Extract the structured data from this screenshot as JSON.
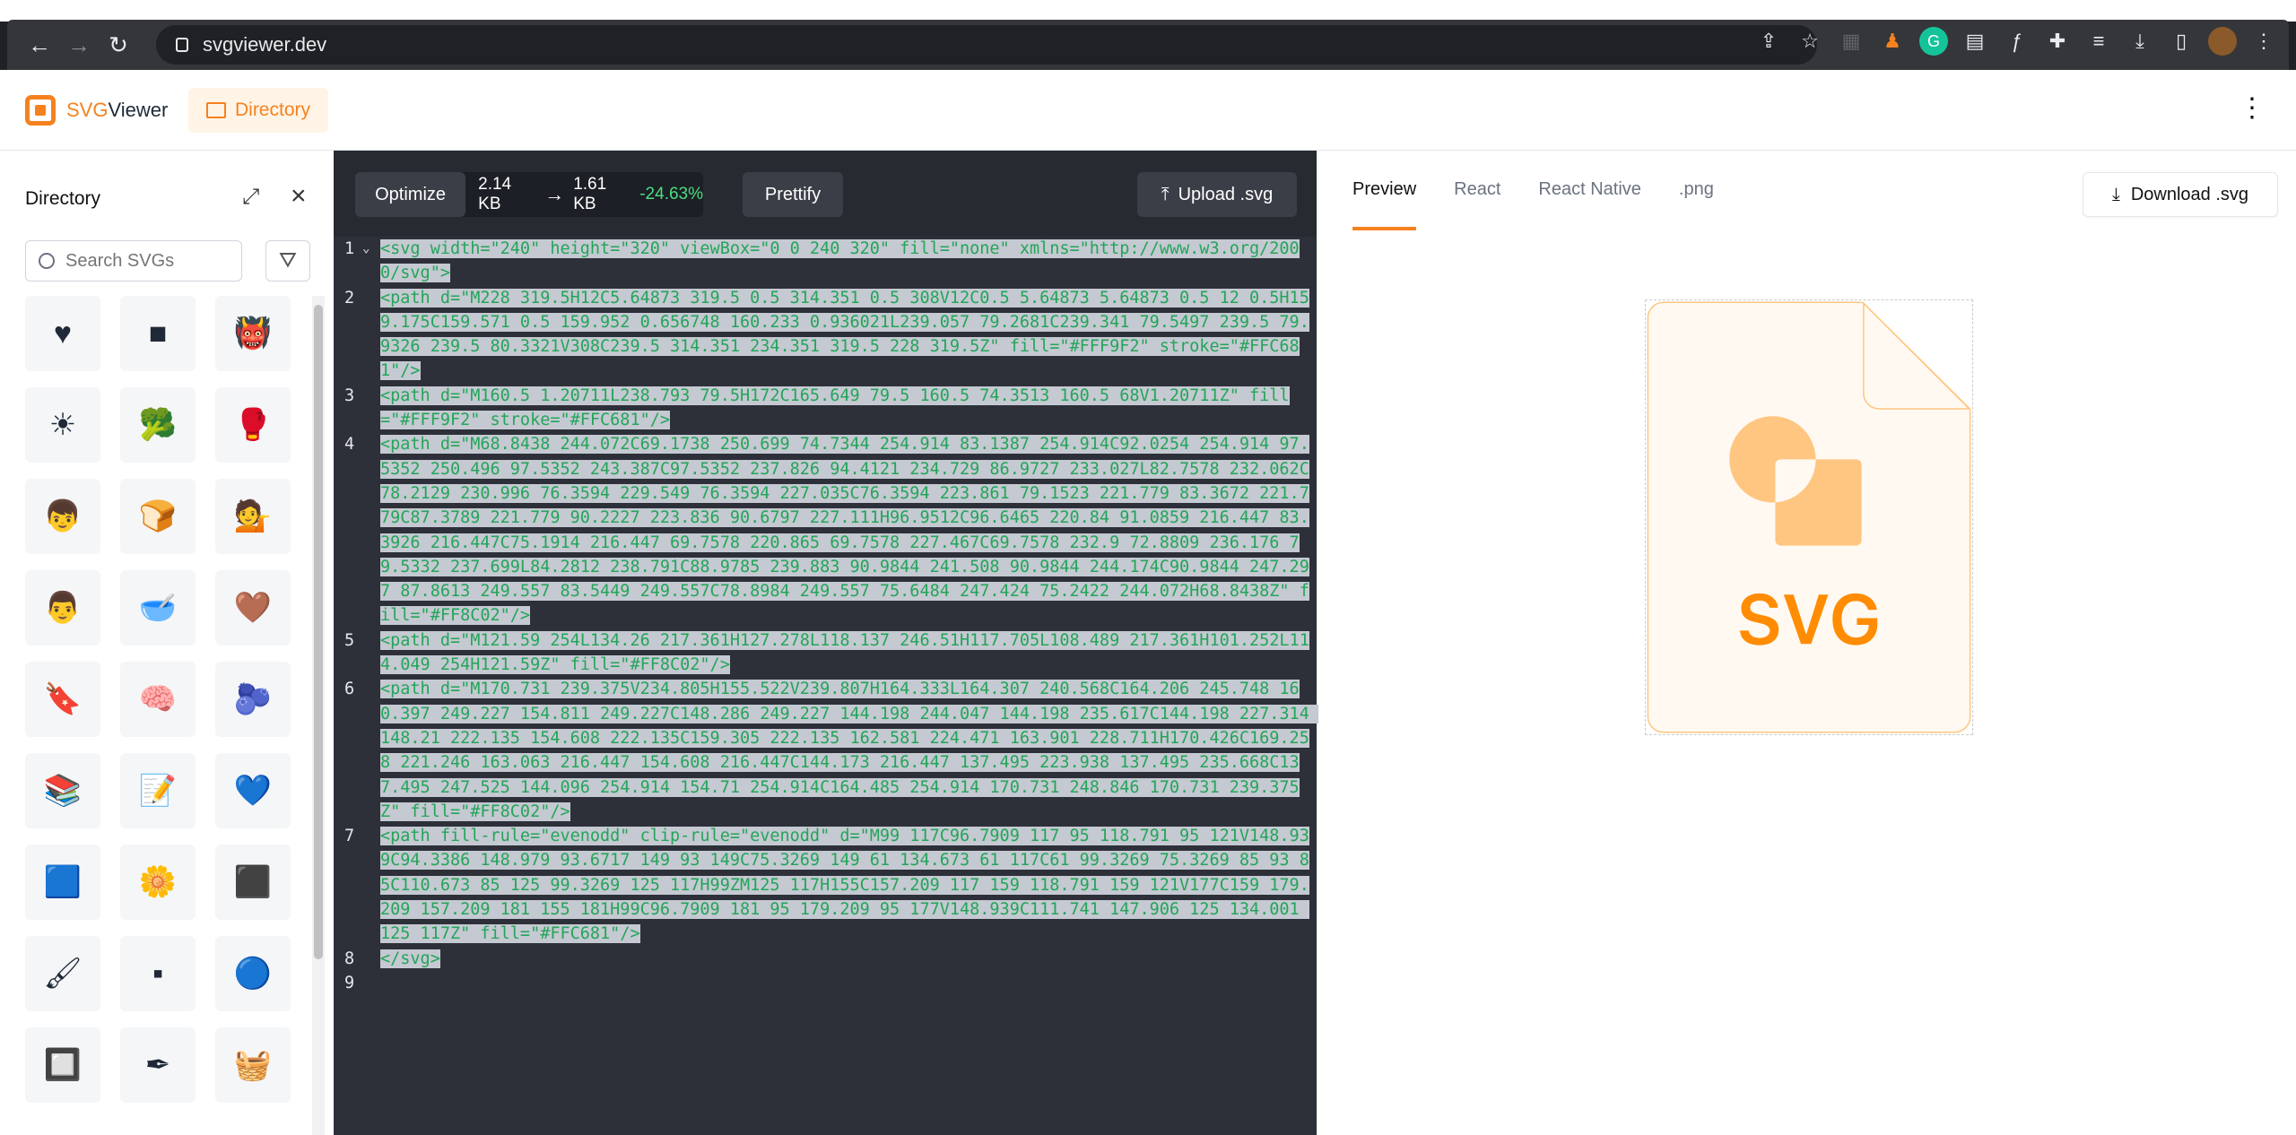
{
  "browser": {
    "url": "svgviewer.dev"
  },
  "header": {
    "logo_svg": "SVG",
    "logo_viewer": "Viewer",
    "directory_label": "Directory"
  },
  "sidebar": {
    "title": "Directory",
    "search_placeholder": "Search SVGs",
    "icons": [
      "heart",
      "black-square",
      "ogre",
      "sun",
      "broccoli",
      "boxing-glove",
      "boy-face",
      "bread",
      "woman-gesture",
      "medium-dark-face",
      "bowl-chopsticks",
      "brown-heart",
      "bookmark-book",
      "brain",
      "blueberries",
      "books",
      "document-pen",
      "blue-heart",
      "blue-square",
      "blossom",
      "dark-square",
      "paintbrush",
      "small-square",
      "blue-circle",
      "white-square-button",
      "fountain-pen",
      "basket"
    ],
    "glyphs": [
      "♥",
      "■",
      "👹",
      "☀",
      "🥦",
      "🥊",
      "👦",
      "🍞",
      "💁",
      "👨",
      "🥣",
      "🤎",
      "🔖",
      "🧠",
      "🫐",
      "📚",
      "📝",
      "💙",
      "🟦",
      "🌼",
      "⬛",
      "🖌",
      "▪",
      "🔵",
      "🔲",
      "✒",
      "🧺"
    ]
  },
  "editor": {
    "optimize_label": "Optimize",
    "size_before": "2.14 KB",
    "size_after": "1.61 KB",
    "size_change": "-24.63%",
    "prettify_label": "Prettify",
    "upload_label": "Upload .svg",
    "lines": [
      {
        "n": "1",
        "text": "<svg width=\"240\" height=\"320\" viewBox=\"0 0 240 320\" fill=\"none\" xmlns=\"http://www.w3.org/2000/svg\">"
      },
      {
        "n": "2",
        "text": "<path d=\"M228 319.5H12C5.64873 319.5 0.5 314.351 0.5 308V12C0.5 5.64873 5.64873 0.5 12 0.5H159.175C159.571 0.5 159.952 0.656748 160.233 0.936021L239.057 79.2681C239.341 79.5497 239.5 79.9326 239.5 80.3321V308C239.5 314.351 234.351 319.5 228 319.5Z\" fill=\"#FFF9F2\" stroke=\"#FFC681\"/>"
      },
      {
        "n": "3",
        "text": "<path d=\"M160.5 1.20711L238.793 79.5H172C165.649 79.5 160.5 74.3513 160.5 68V1.20711Z\" fill=\"#FFF9F2\" stroke=\"#FFC681\"/>"
      },
      {
        "n": "4",
        "text": "<path d=\"M68.8438 244.072C69.1738 250.699 74.7344 254.914 83.1387 254.914C92.0254 254.914 97.5352 250.496 97.5352 243.387C97.5352 237.826 94.4121 234.729 86.9727 233.027L82.7578 232.062C78.2129 230.996 76.3594 229.549 76.3594 227.035C76.3594 223.861 79.1523 221.779 83.3672 221.779C87.3789 221.779 90.2227 223.836 90.6797 227.111H96.9512C96.6465 220.84 91.0859 216.447 83.3926 216.447C75.1914 216.447 69.7578 220.865 69.7578 227.467C69.7578 232.9 72.8809 236.176 79.5332 237.699L84.2812 238.791C88.9785 239.883 90.9844 241.508 90.9844 244.174C90.9844 247.297 87.8613 249.557 83.5449 249.557C78.8984 249.557 75.6484 247.424 75.2422 244.072H68.8438Z\" fill=\"#FF8C02\"/>"
      },
      {
        "n": "5",
        "text": "<path d=\"M121.59 254L134.26 217.361H127.278L118.137 246.51H117.705L108.489 217.361H101.252L114.049 254H121.59Z\" fill=\"#FF8C02\"/>"
      },
      {
        "n": "6",
        "text": "<path d=\"M170.731 239.375V234.805H155.522V239.807H164.333L164.307 240.568C164.206 245.748 160.397 249.227 154.811 249.227C148.286 249.227 144.198 244.047 144.198 235.617C144.198 227.314 148.21 222.135 154.608 222.135C159.305 222.135 162.581 224.471 163.901 228.711H170.426C169.258 221.246 163.063 216.447 154.608 216.447C144.173 216.447 137.495 223.938 137.495 235.668C137.495 247.525 144.096 254.914 154.71 254.914C164.485 254.914 170.731 248.846 170.731 239.375Z\" fill=\"#FF8C02\"/>"
      },
      {
        "n": "7",
        "text": "<path fill-rule=\"evenodd\" clip-rule=\"evenodd\" d=\"M99 117C96.7909 117 95 118.791 95 121V148.939C94.3386 148.979 93.6717 149 93 149C75.3269 149 61 134.673 61 117C61 99.3269 75.3269 85 93 85C110.673 85 125 99.3269 125 117H99ZM125 117H155C157.209 117 159 118.791 159 121V177C159 179.209 157.209 181 155 181H99C96.7909 181 95 179.209 95 177V148.939C111.741 147.906 125 134.001 125 117Z\" fill=\"#FFC681\"/>"
      },
      {
        "n": "8",
        "text": "</svg>"
      },
      {
        "n": "9",
        "text": ""
      }
    ]
  },
  "preview": {
    "tabs": [
      "Preview",
      "React",
      "React Native",
      ".png"
    ],
    "download_label": "Download .svg",
    "colors": {
      "accent": "#f5821f",
      "light": "#FFC681",
      "bg": "#FFF9F2",
      "text": "#FF8C02"
    }
  }
}
